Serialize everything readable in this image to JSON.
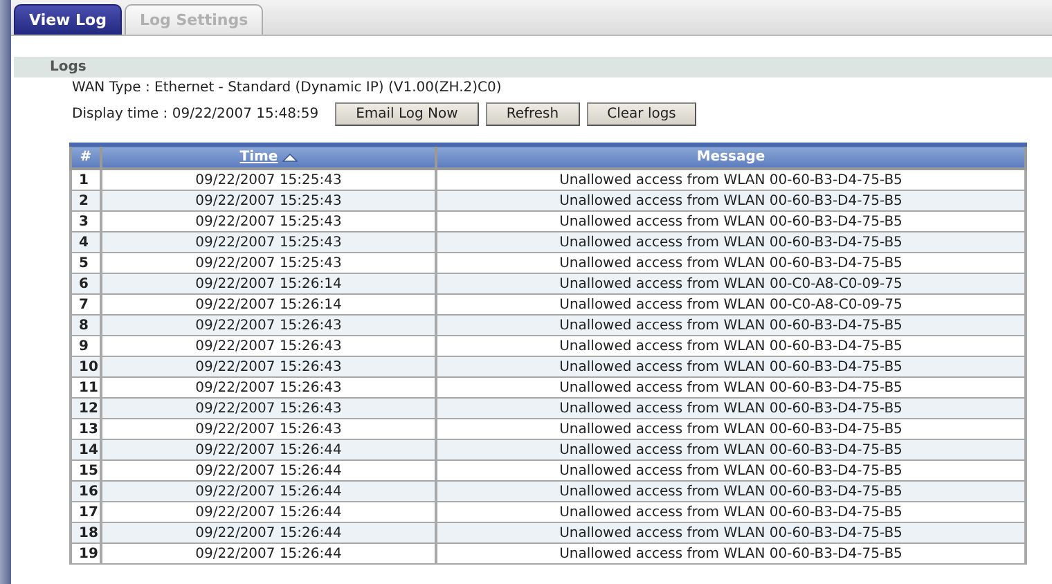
{
  "tabs": [
    {
      "label": "View Log",
      "selected": true
    },
    {
      "label": "Log Settings",
      "selected": false
    }
  ],
  "section_title": "Logs",
  "wan_type": "WAN Type : Ethernet - Standard (Dynamic IP) (V1.00(ZH.2)C0)",
  "display_time": "Display time : 09/22/2007 15:48:59",
  "buttons": [
    "Email Log Now",
    "Refresh",
    "Clear logs"
  ],
  "table": {
    "columns": [
      {
        "label": "#",
        "sorted": false
      },
      {
        "label": "Time",
        "sorted": true
      },
      {
        "label": "Message",
        "sorted": false
      }
    ],
    "rows": [
      [
        "1",
        "09/22/2007 15:25:43",
        "Unallowed access from WLAN 00-60-B3-D4-75-B5"
      ],
      [
        "2",
        "09/22/2007 15:25:43",
        "Unallowed access from WLAN 00-60-B3-D4-75-B5"
      ],
      [
        "3",
        "09/22/2007 15:25:43",
        "Unallowed access from WLAN 00-60-B3-D4-75-B5"
      ],
      [
        "4",
        "09/22/2007 15:25:43",
        "Unallowed access from WLAN 00-60-B3-D4-75-B5"
      ],
      [
        "5",
        "09/22/2007 15:25:43",
        "Unallowed access from WLAN 00-60-B3-D4-75-B5"
      ],
      [
        "6",
        "09/22/2007 15:26:14",
        "Unallowed access from WLAN 00-C0-A8-C0-09-75"
      ],
      [
        "7",
        "09/22/2007 15:26:14",
        "Unallowed access from WLAN 00-C0-A8-C0-09-75"
      ],
      [
        "8",
        "09/22/2007 15:26:43",
        "Unallowed access from WLAN 00-60-B3-D4-75-B5"
      ],
      [
        "9",
        "09/22/2007 15:26:43",
        "Unallowed access from WLAN 00-60-B3-D4-75-B5"
      ],
      [
        "10",
        "09/22/2007 15:26:43",
        "Unallowed access from WLAN 00-60-B3-D4-75-B5"
      ],
      [
        "11",
        "09/22/2007 15:26:43",
        "Unallowed access from WLAN 00-60-B3-D4-75-B5"
      ],
      [
        "12",
        "09/22/2007 15:26:43",
        "Unallowed access from WLAN 00-60-B3-D4-75-B5"
      ],
      [
        "13",
        "09/22/2007 15:26:43",
        "Unallowed access from WLAN 00-60-B3-D4-75-B5"
      ],
      [
        "14",
        "09/22/2007 15:26:44",
        "Unallowed access from WLAN 00-60-B3-D4-75-B5"
      ],
      [
        "15",
        "09/22/2007 15:26:44",
        "Unallowed access from WLAN 00-60-B3-D4-75-B5"
      ],
      [
        "16",
        "09/22/2007 15:26:44",
        "Unallowed access from WLAN 00-60-B3-D4-75-B5"
      ],
      [
        "17",
        "09/22/2007 15:26:44",
        "Unallowed access from WLAN 00-60-B3-D4-75-B5"
      ],
      [
        "18",
        "09/22/2007 15:26:44",
        "Unallowed access from WLAN 00-60-B3-D4-75-B5"
      ],
      [
        "19",
        "09/22/2007 15:26:44",
        "Unallowed access from WLAN 00-60-B3-D4-75-B5"
      ]
    ]
  }
}
